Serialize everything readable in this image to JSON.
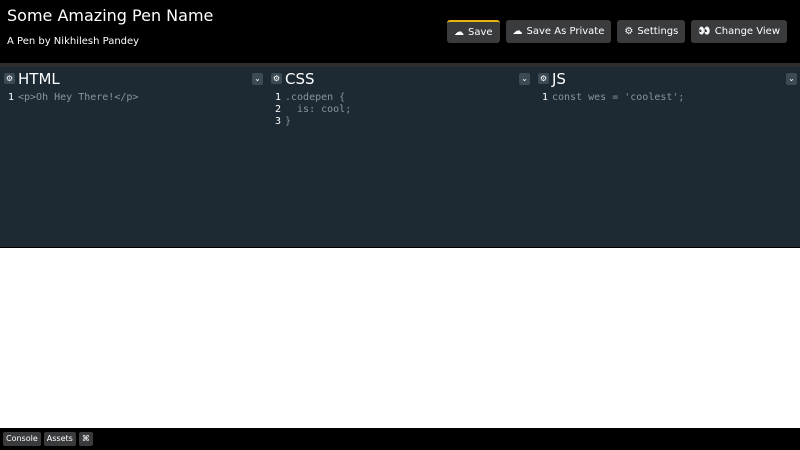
{
  "header": {
    "title": "Some Amazing Pen Name",
    "author": "A Pen by Nikhilesh Pandey",
    "buttons": {
      "save": {
        "icon": "☁",
        "label": "Save"
      },
      "save_private": {
        "icon": "☁",
        "label": "Save As Private"
      },
      "settings": {
        "icon": "⚙",
        "label": "Settings"
      },
      "change_view": {
        "icon": "👀",
        "label": "Change View"
      }
    }
  },
  "editors": {
    "html": {
      "name": "HTML",
      "gear": "⚙",
      "collapse": "⌄",
      "lines": [
        {
          "n": "1",
          "code": "<p>Oh Hey There!</p>"
        }
      ]
    },
    "css": {
      "name": "CSS",
      "gear": "⚙",
      "collapse": "⌄",
      "lines": [
        {
          "n": "1",
          "code": ".codepen {"
        },
        {
          "n": "2",
          "code": "  is: cool;"
        },
        {
          "n": "3",
          "code": "}"
        }
      ]
    },
    "js": {
      "name": "JS",
      "gear": "⚙",
      "collapse": "⌄",
      "lines": [
        {
          "n": "1",
          "code": "const wes = 'coolest';"
        }
      ]
    }
  },
  "footer": {
    "console": "Console",
    "assets": "Assets",
    "shortcuts": "⌘"
  },
  "colors": {
    "accent": "#e6b40f",
    "editor_bg": "#1d2a33",
    "button_bg": "#3a3b3d"
  }
}
